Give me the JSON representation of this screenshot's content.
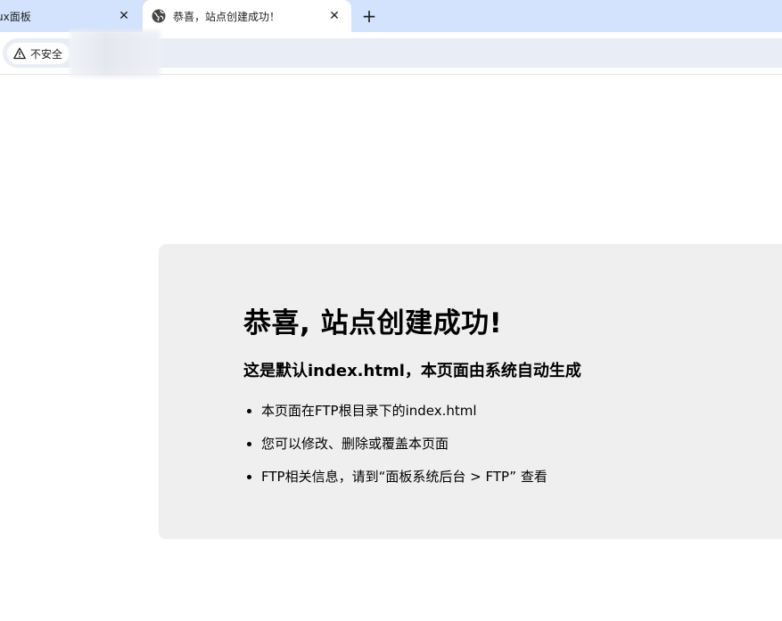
{
  "tabs": [
    {
      "title": "ux面板",
      "active": false
    },
    {
      "title": "恭喜，站点创建成功！",
      "active": true
    }
  ],
  "tab_close_glyph": "✕",
  "new_tab_glyph": "+",
  "address_bar": {
    "security_label": "不安全",
    "security_icon": "warning-triangle-icon",
    "url_redacted": true
  },
  "page": {
    "title": "恭喜, 站点创建成功!",
    "subtitle": "这是默认index.html，本页面由系统自动生成",
    "bullets": [
      "本页面在FTP根目录下的index.html",
      "您可以修改、删除或覆盖本页面",
      "FTP相关信息，请到“面板系统后台 > FTP” 查看"
    ]
  },
  "colors": {
    "tabbar_bg": "#d3e3fd",
    "omnibox_bg": "#e9eef6",
    "panel_bg": "#efefef"
  }
}
